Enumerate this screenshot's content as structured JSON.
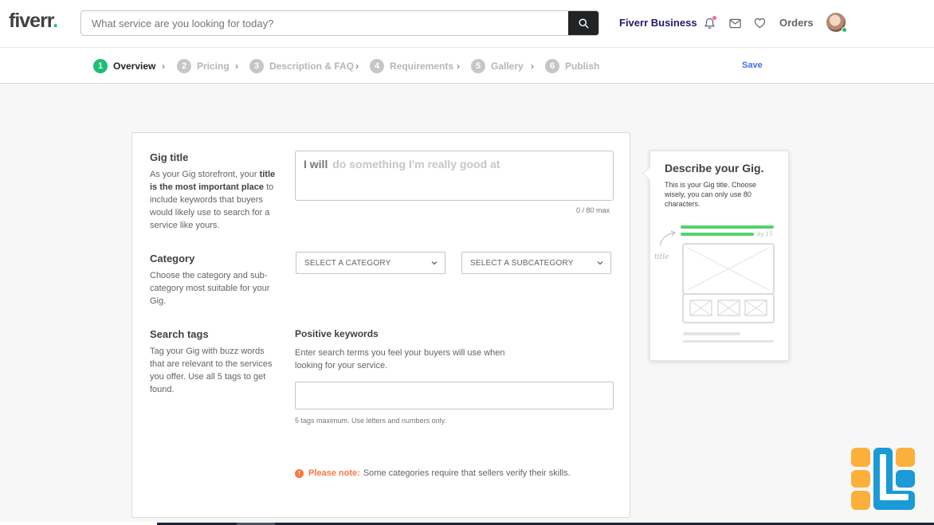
{
  "header": {
    "logo_text": "fiverr",
    "logo_dot": ".",
    "search_placeholder": "What service are you looking for today?",
    "business_label": "Fiverr Business",
    "orders_label": "Orders",
    "icons": [
      "search-icon",
      "bell-icon",
      "mail-icon",
      "heart-icon"
    ]
  },
  "steps": [
    {
      "num": "1",
      "label": "Overview",
      "active": true
    },
    {
      "num": "2",
      "label": "Pricing"
    },
    {
      "num": "3",
      "label": "Description & FAQ"
    },
    {
      "num": "4",
      "label": "Requirements"
    },
    {
      "num": "5",
      "label": "Gallery"
    },
    {
      "num": "6",
      "label": "Publish"
    }
  ],
  "save_label": "Save",
  "form": {
    "gig_title": {
      "label": "Gig title",
      "desc_pre": "As your Gig storefront, your ",
      "desc_bold": "title is the most important place",
      "desc_post": " to include keywords that buyers would likely use to search for a service like yours.",
      "prefix": "I will",
      "placeholder": "do something I'm really good at",
      "counter": "0 / 80 max"
    },
    "category": {
      "label": "Category",
      "desc": "Choose the category and sub-category most suitable for your Gig.",
      "select_category": "SELECT A CATEGORY",
      "select_subcategory": "SELECT A SUBCATEGORY"
    },
    "search_tags": {
      "label": "Search tags",
      "desc": "Tag your Gig with buzz words that are relevant to the services you offer. Use all 5 tags to get found.",
      "positive_label": "Positive keywords",
      "positive_desc": "Enter search terms you feel your buyers will use when looking for your service.",
      "help": "5 tags maximum. Use letters and numbers only."
    },
    "note": {
      "strong": "Please note:",
      "text": "Some categories require that sellers verify their skills."
    }
  },
  "tip": {
    "title": "Describe your Gig.",
    "body": "This is your Gig title. Choose wisely, you can only use 80 characters.",
    "illus_label": "title",
    "illus_hint": "by 15"
  },
  "colors": {
    "brand_green": "#1dbf73",
    "link_blue": "#446ee7",
    "warning_orange": "#ff7640",
    "business_navy": "#1f1b6c"
  }
}
